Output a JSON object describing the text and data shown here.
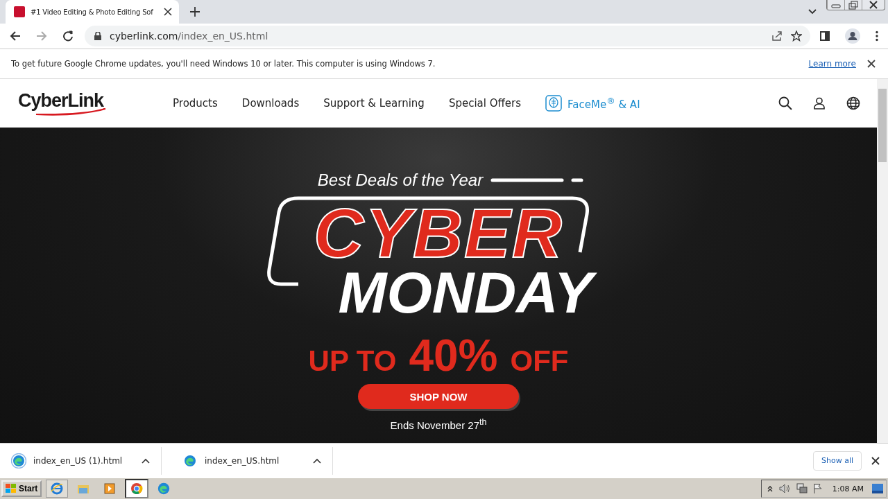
{
  "browser": {
    "tab_title": "#1 Video Editing & Photo Editing Sof",
    "url_host": "cyberlink.com",
    "url_path": "/index_en_US.html"
  },
  "infobar": {
    "message": "To get future Google Chrome updates, you'll need Windows 10 or later. This computer is using Windows 7.",
    "link": "Learn more"
  },
  "site": {
    "logo": "CyberLink",
    "nav": [
      {
        "label": "Products",
        "kind": "plain"
      },
      {
        "label": "Downloads",
        "kind": "plain"
      },
      {
        "label": "Support & Learning",
        "kind": "plain"
      },
      {
        "label": "Special Offers",
        "kind": "plain"
      },
      {
        "label": "FaceMe$^{®}$ & AI",
        "kind": "faceme"
      }
    ]
  },
  "hero": {
    "eyebrow": "Best Deals of the Year",
    "headline_1": "CYBER",
    "headline_2": "MONDAY",
    "offer_1": "UP TO",
    "offer_2": "40%",
    "offer_3": "OFF",
    "button": "SHOP NOW",
    "ends": "Ends November 27$^{th}$"
  },
  "downloads": {
    "items": [
      {
        "name": "index_en_US (1).html"
      },
      {
        "name": "index_en_US.html"
      }
    ],
    "show_all": "Show all"
  },
  "taskbar": {
    "start": "Start",
    "clock": "1:08 AM"
  }
}
